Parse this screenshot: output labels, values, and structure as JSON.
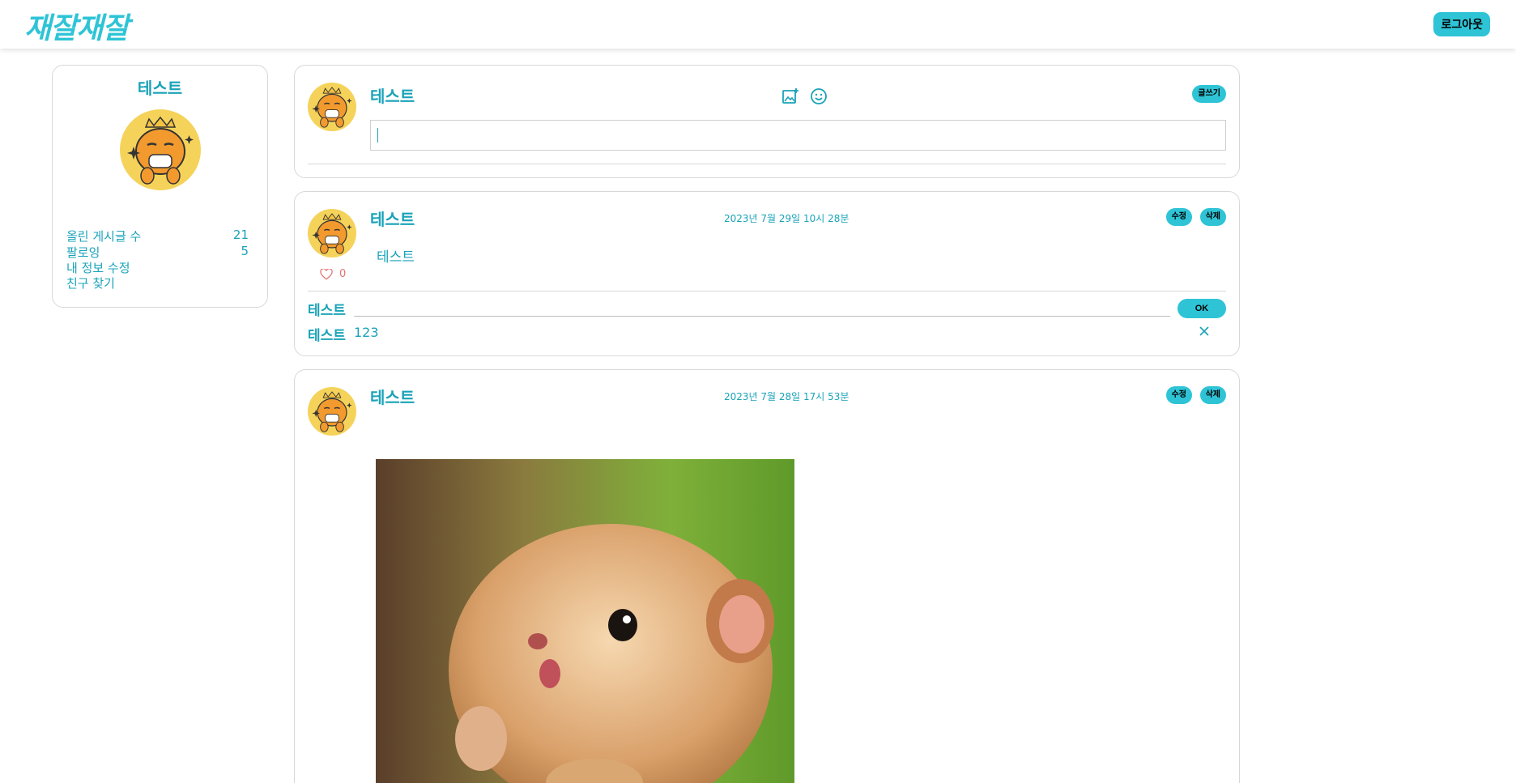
{
  "header": {
    "logo": "재잘재잘",
    "logout_label": "로그아웃"
  },
  "profile": {
    "name": "테스트",
    "stats": [
      {
        "label": "올린 게시글 수",
        "value": "21"
      },
      {
        "label": "팔로잉",
        "value": "5"
      }
    ],
    "links": [
      "내 정보 수정",
      "친구 찾기"
    ]
  },
  "composer": {
    "user": "테스트",
    "submit_label": "글쓰기",
    "input_value": ""
  },
  "posts": [
    {
      "user": "테스트",
      "date": "2023년 7월 29일 10시 28분",
      "edit_label": "수정",
      "delete_label": "삭제",
      "content": "테스트",
      "likes": "0",
      "comment_input_user": "테스트",
      "ok_label": "OK",
      "comments": [
        {
          "user": "테스트",
          "text": "123"
        }
      ]
    },
    {
      "user": "테스트",
      "date": "2023년 7월 28일 17시 53분",
      "edit_label": "수정",
      "delete_label": "삭제"
    }
  ],
  "colors": {
    "accent": "#2ec4d6",
    "text": "#1aa3b8",
    "heart": "#e57373",
    "avatar_bg": "#f5d35a"
  },
  "icons": [
    "image-add-icon",
    "emoji-icon",
    "heart-icon",
    "close-icon"
  ]
}
